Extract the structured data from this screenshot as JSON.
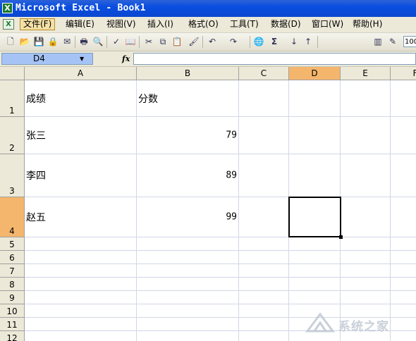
{
  "window": {
    "title": "Microsoft Excel - Book1",
    "app_icon": "X"
  },
  "menu": {
    "doc_icon": "X",
    "items": [
      {
        "label": "文件(F)",
        "active": true
      },
      {
        "label": "编辑(E)"
      },
      {
        "label": "视图(V)"
      },
      {
        "label": "插入(I)"
      },
      {
        "label": "格式(O)"
      },
      {
        "label": "工具(T)"
      },
      {
        "label": "数据(D)"
      },
      {
        "label": "窗口(W)"
      },
      {
        "label": "帮助(H)"
      }
    ]
  },
  "toolbar": {
    "buttons": [
      {
        "icon": "new-icon",
        "glyph": "🗋"
      },
      {
        "icon": "open-icon",
        "glyph": "📂"
      },
      {
        "icon": "save-icon",
        "glyph": "💾"
      },
      {
        "icon": "permission-icon",
        "glyph": "🔒"
      },
      {
        "icon": "email-icon",
        "glyph": "✉"
      },
      {
        "icon": "print-icon",
        "glyph": "🖶"
      },
      {
        "icon": "print-preview-icon",
        "glyph": "🔍"
      },
      {
        "icon": "spelling-icon",
        "glyph": "✓"
      },
      {
        "icon": "research-icon",
        "glyph": "📖"
      },
      {
        "icon": "cut-icon",
        "glyph": "✂"
      },
      {
        "icon": "copy-icon",
        "glyph": "⧉"
      },
      {
        "icon": "paste-icon",
        "glyph": "📋"
      },
      {
        "icon": "format-painter-icon",
        "glyph": "🖌"
      },
      {
        "icon": "undo-icon",
        "glyph": "↶"
      },
      {
        "icon": "redo-icon",
        "glyph": "↷"
      },
      {
        "icon": "hyperlink-icon",
        "glyph": "🌐"
      },
      {
        "icon": "autosum-icon",
        "glyph": "Σ"
      },
      {
        "icon": "sort-ascending-icon",
        "glyph": "↓"
      },
      {
        "icon": "sort-descending-icon",
        "glyph": "↑"
      },
      {
        "icon": "chart-wizard-icon",
        "glyph": "▥"
      },
      {
        "icon": "drawing-icon",
        "glyph": "✎"
      }
    ],
    "zoom": "100"
  },
  "formula_bar": {
    "name_box": "D4",
    "fx_label": "fx",
    "formula": ""
  },
  "sheet": {
    "columns": [
      "A",
      "B",
      "C",
      "D",
      "E",
      "F"
    ],
    "selected_column": "D",
    "rows": [
      {
        "number": "1",
        "a": "成绩",
        "b": "分数"
      },
      {
        "number": "2",
        "a": "张三",
        "b": "79"
      },
      {
        "number": "3",
        "a": "李四",
        "b": "89"
      },
      {
        "number": "4",
        "a": "赵五",
        "b": "99"
      },
      {
        "number": "5"
      },
      {
        "number": "6"
      },
      {
        "number": "7"
      },
      {
        "number": "8"
      },
      {
        "number": "9"
      },
      {
        "number": "10"
      },
      {
        "number": "11"
      },
      {
        "number": "12"
      }
    ],
    "selected_row": "4",
    "active_cell": "D4"
  },
  "watermark": {
    "text": "系统之家"
  }
}
